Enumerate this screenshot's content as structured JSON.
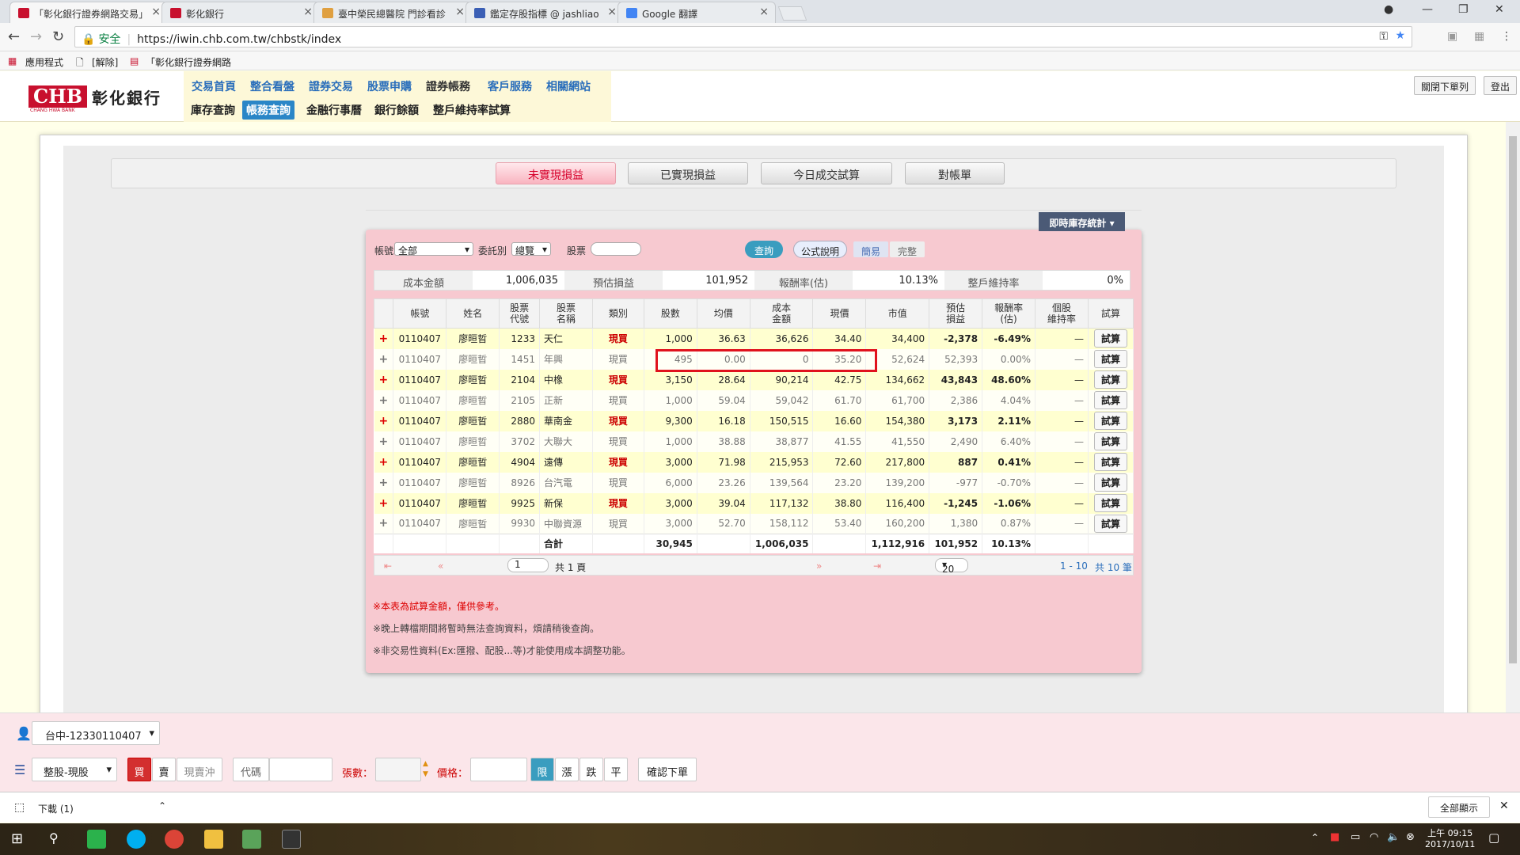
{
  "browser": {
    "tabs": [
      {
        "title": "「彰化銀行證券網路交易」",
        "active": true,
        "fav_color": "#c8102e"
      },
      {
        "title": "彰化銀行",
        "active": false,
        "fav_color": "#c8102e"
      },
      {
        "title": "臺中榮民總醫院 門診看診",
        "active": false,
        "fav_color": "#e0a040"
      },
      {
        "title": "鑑定存股指標 @ jashliao",
        "active": false,
        "fav_color": "#3b5fb5"
      },
      {
        "title": "Google 翻譯",
        "active": false,
        "fav_color": "#4285f4"
      }
    ],
    "secure_label": "安全",
    "url": "https://iwin.chb.com.tw/chbstk/index",
    "bookmarks": [
      "應用程式",
      "[解除]",
      "「彰化銀行證券網路"
    ]
  },
  "site": {
    "logo_text": "CHB",
    "logo_name": "彰化銀行",
    "logo_sub": "CHANG HWA BANK",
    "nav1": [
      "交易首頁",
      "整合看盤",
      "證券交易",
      "股票申購",
      "證券帳務",
      "客戶服務",
      "相關網站"
    ],
    "nav1_selected": "證券帳務",
    "nav2": [
      "庫存查詢",
      "帳務查詢",
      "金融行事曆",
      "銀行餘額",
      "整戶維持率試算"
    ],
    "nav2_selected": "帳務查詢",
    "close_order_btn": "關閉下單列",
    "logout_btn": "登出"
  },
  "page_tabs": [
    "未實現損益",
    "已實現損益",
    "今日成交試算",
    "對帳單"
  ],
  "stat_btn": "即時庫存統計",
  "filters": {
    "account_label": "帳號",
    "account_value": "全部",
    "order_type_label": "委託別",
    "order_type_value": "總覽",
    "stock_label": "股票",
    "query_btn": "查詢",
    "formula_btn": "公式說明",
    "simple_btn": "簡易",
    "full_btn": "完整"
  },
  "summary": {
    "cost_label": "成本金額",
    "cost_value": "1,006,035",
    "pl_label": "預估損益",
    "pl_value": "101,952",
    "roi_label": "報酬率(估)",
    "roi_value": "10.13%",
    "maint_label": "整戶維持率",
    "maint_value": "0%"
  },
  "table": {
    "headers": [
      "",
      "帳號",
      "姓名",
      "股票\n代號",
      "股票\n名稱",
      "類別",
      "股數",
      "均價",
      "成本\n金額",
      "現價",
      "市值",
      "預估\n損益",
      "報酬率\n(估)",
      "個股\n維持率",
      "試算"
    ],
    "rows": [
      {
        "acct": "0110407",
        "name": "廖晅晢",
        "code": "1233",
        "sname": "天仁",
        "cat": "現買",
        "qty": "1,000",
        "avg": "36.63",
        "cost": "36,626",
        "price": "34.40",
        "mv": "34,400",
        "pl": "-2,378",
        "roi": "-6.49%",
        "maint": "—",
        "btn": "試算"
      },
      {
        "acct": "0110407",
        "name": "廖晅晢",
        "code": "1451",
        "sname": "年興",
        "cat": "現買",
        "qty": "495",
        "avg": "0.00",
        "cost": "0",
        "price": "35.20",
        "mv": "52,624",
        "pl": "52,393",
        "roi": "0.00%",
        "maint": "—",
        "btn": "試算"
      },
      {
        "acct": "0110407",
        "name": "廖晅晢",
        "code": "2104",
        "sname": "中橡",
        "cat": "現買",
        "qty": "3,150",
        "avg": "28.64",
        "cost": "90,214",
        "price": "42.75",
        "mv": "134,662",
        "pl": "43,843",
        "roi": "48.60%",
        "maint": "—",
        "btn": "試算"
      },
      {
        "acct": "0110407",
        "name": "廖晅晢",
        "code": "2105",
        "sname": "正新",
        "cat": "現買",
        "qty": "1,000",
        "avg": "59.04",
        "cost": "59,042",
        "price": "61.70",
        "mv": "61,700",
        "pl": "2,386",
        "roi": "4.04%",
        "maint": "—",
        "btn": "試算"
      },
      {
        "acct": "0110407",
        "name": "廖晅晢",
        "code": "2880",
        "sname": "華南金",
        "cat": "現買",
        "qty": "9,300",
        "avg": "16.18",
        "cost": "150,515",
        "price": "16.60",
        "mv": "154,380",
        "pl": "3,173",
        "roi": "2.11%",
        "maint": "—",
        "btn": "試算"
      },
      {
        "acct": "0110407",
        "name": "廖晅晢",
        "code": "3702",
        "sname": "大聯大",
        "cat": "現買",
        "qty": "1,000",
        "avg": "38.88",
        "cost": "38,877",
        "price": "41.55",
        "mv": "41,550",
        "pl": "2,490",
        "roi": "6.40%",
        "maint": "—",
        "btn": "試算"
      },
      {
        "acct": "0110407",
        "name": "廖晅晢",
        "code": "4904",
        "sname": "遠傳",
        "cat": "現買",
        "qty": "3,000",
        "avg": "71.98",
        "cost": "215,953",
        "price": "72.60",
        "mv": "217,800",
        "pl": "887",
        "roi": "0.41%",
        "maint": "—",
        "btn": "試算"
      },
      {
        "acct": "0110407",
        "name": "廖晅晢",
        "code": "8926",
        "sname": "台汽電",
        "cat": "現買",
        "qty": "6,000",
        "avg": "23.26",
        "cost": "139,564",
        "price": "23.20",
        "mv": "139,200",
        "pl": "-977",
        "roi": "-0.70%",
        "maint": "—",
        "btn": "試算"
      },
      {
        "acct": "0110407",
        "name": "廖晅晢",
        "code": "9925",
        "sname": "新保",
        "cat": "現買",
        "qty": "3,000",
        "avg": "39.04",
        "cost": "117,132",
        "price": "38.80",
        "mv": "116,400",
        "pl": "-1,245",
        "roi": "-1.06%",
        "maint": "—",
        "btn": "試算"
      },
      {
        "acct": "0110407",
        "name": "廖晅晢",
        "code": "9930",
        "sname": "中聯資源",
        "cat": "現買",
        "qty": "3,000",
        "avg": "52.70",
        "cost": "158,112",
        "price": "53.40",
        "mv": "160,200",
        "pl": "1,380",
        "roi": "0.87%",
        "maint": "—",
        "btn": "試算"
      }
    ],
    "total": {
      "label": "合計",
      "qty": "30,945",
      "cost": "1,006,035",
      "mv": "1,112,916",
      "pl": "101,952",
      "roi": "10.13%"
    }
  },
  "pager": {
    "page": "1",
    "total_pages": "共 1 頁",
    "page_size": "20",
    "range": "1 - 10",
    "total_count": "共 10 筆"
  },
  "notes": [
    "※本表為試算金額，僅供參考。",
    "※晚上轉檔期間將暫時無法查詢資料，煩請稍後查詢。",
    "※非交易性資料(Ex:匯撥、配股...等)才能使用成本調整功能。"
  ],
  "order_bar": {
    "account": "台中-12330110407",
    "trade_type": "整股-現股",
    "buy": "買",
    "sell": "賣",
    "daytrade": "現賣沖",
    "code_label": "代碼",
    "qty_label": "張數：",
    "price_label": "價格：",
    "limit": "限",
    "up": "漲",
    "down": "跌",
    "flat": "平",
    "confirm": "確認下單"
  },
  "download": {
    "label": "下載 (1)",
    "show_all": "全部顯示"
  },
  "taskbar": {
    "time": "上午 09:15",
    "date": "2017/10/11"
  }
}
